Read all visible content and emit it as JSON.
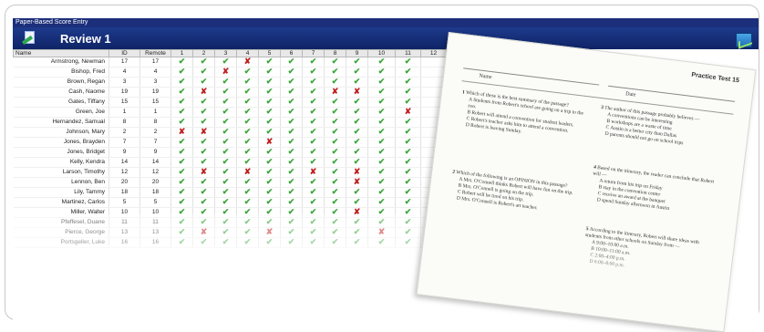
{
  "window_title": "Paper-Based Score Entry",
  "header_title": "Review 1",
  "columns": [
    "Name",
    "ID",
    "Remote",
    "1",
    "2",
    "3",
    "4",
    "5",
    "6",
    "7",
    "8",
    "9",
    "10",
    "11",
    "12"
  ],
  "rows": [
    {
      "name": "Armstrong, Newman",
      "id": "17",
      "remote": "17",
      "marks": [
        "c",
        "c",
        "c",
        "x",
        "c",
        "c",
        "c",
        "c",
        "c",
        "c",
        "c"
      ]
    },
    {
      "name": "Bishop, Fred",
      "id": "4",
      "remote": "4",
      "marks": [
        "c",
        "c",
        "x",
        "c",
        "c",
        "c",
        "c",
        "c",
        "c",
        "c",
        "c"
      ]
    },
    {
      "name": "Brown, Regan",
      "id": "3",
      "remote": "3",
      "marks": [
        "c",
        "c",
        "c",
        "c",
        "c",
        "c",
        "c",
        "c",
        "c",
        "c",
        "c"
      ]
    },
    {
      "name": "Cash, Naome",
      "id": "19",
      "remote": "19",
      "marks": [
        "c",
        "x",
        "c",
        "c",
        "c",
        "c",
        "c",
        "x",
        "x",
        "c",
        "c"
      ]
    },
    {
      "name": "Gates, Tiffany",
      "id": "15",
      "remote": "15",
      "marks": [
        "c",
        "c",
        "c",
        "c",
        "c",
        "c",
        "c",
        "c",
        "c",
        "c",
        "c"
      ]
    },
    {
      "name": "Green, Joe",
      "id": "1",
      "remote": "1",
      "marks": [
        "c",
        "c",
        "c",
        "c",
        "c",
        "c",
        "c",
        "c",
        "c",
        "c",
        "x"
      ]
    },
    {
      "name": "Hernandez, Samual",
      "id": "8",
      "remote": "8",
      "marks": [
        "c",
        "c",
        "c",
        "c",
        "c",
        "c",
        "c",
        "c",
        "c",
        "c",
        "c"
      ]
    },
    {
      "name": "Johnson, Mary",
      "id": "2",
      "remote": "2",
      "marks": [
        "x",
        "x",
        "c",
        "c",
        "c",
        "c",
        "c",
        "c",
        "c",
        "c",
        "c"
      ]
    },
    {
      "name": "Jones, Brayden",
      "id": "7",
      "remote": "7",
      "marks": [
        "c",
        "c",
        "c",
        "c",
        "x",
        "c",
        "c",
        "c",
        "c",
        "c",
        "c"
      ]
    },
    {
      "name": "Jones, Bridget",
      "id": "9",
      "remote": "9",
      "marks": [
        "c",
        "c",
        "c",
        "c",
        "c",
        "c",
        "c",
        "c",
        "c",
        "c",
        "c"
      ]
    },
    {
      "name": "Kelly, Kendra",
      "id": "14",
      "remote": "14",
      "marks": [
        "c",
        "c",
        "c",
        "c",
        "c",
        "c",
        "c",
        "c",
        "c",
        "c",
        "c"
      ]
    },
    {
      "name": "Larson, Timothy",
      "id": "12",
      "remote": "12",
      "marks": [
        "c",
        "x",
        "c",
        "x",
        "c",
        "c",
        "x",
        "c",
        "x",
        "c",
        "c"
      ]
    },
    {
      "name": "Lennon, Ben",
      "id": "20",
      "remote": "20",
      "marks": [
        "c",
        "c",
        "c",
        "c",
        "c",
        "c",
        "c",
        "c",
        "x",
        "c",
        "c"
      ]
    },
    {
      "name": "Lily, Tammy",
      "id": "18",
      "remote": "18",
      "marks": [
        "c",
        "c",
        "c",
        "c",
        "c",
        "c",
        "c",
        "c",
        "c",
        "c",
        "c"
      ]
    },
    {
      "name": "Martinez, Carlos",
      "id": "5",
      "remote": "5",
      "marks": [
        "c",
        "c",
        "c",
        "c",
        "c",
        "c",
        "c",
        "c",
        "c",
        "c",
        "c"
      ]
    },
    {
      "name": "Miller, Walter",
      "id": "10",
      "remote": "10",
      "marks": [
        "c",
        "c",
        "c",
        "c",
        "c",
        "c",
        "c",
        "c",
        "x",
        "c",
        "c"
      ]
    },
    {
      "name": "Pfeffesel, Duane",
      "id": "11",
      "remote": "11",
      "marks": [
        "c",
        "c",
        "c",
        "c",
        "c",
        "c",
        "c",
        "c",
        "c",
        "c",
        "c"
      ]
    },
    {
      "name": "Pierce, George",
      "id": "13",
      "remote": "13",
      "marks": [
        "c",
        "x",
        "c",
        "c",
        "x",
        "c",
        "c",
        "c",
        "c",
        "x",
        "c"
      ]
    },
    {
      "name": "Portsgeller, Luke",
      "id": "16",
      "remote": "16",
      "marks": [
        "c",
        "c",
        "c",
        "c",
        "c",
        "c",
        "c",
        "c",
        "c",
        "c",
        "c"
      ]
    }
  ],
  "paper": {
    "test_title": "Practice Test 15",
    "name_label": "Name",
    "date_label": "Date",
    "q1": "Which of these is the best summary of the passage?",
    "q1_opts": [
      "Students from Robert's school are going on a trip to the zoo.",
      "Robert will attend a convention for student leaders.",
      "Robert's teacher asks him to attend a convention.",
      "Robert is leaving Sunday."
    ],
    "q2": "Which of the following is an OPINION in this passage?",
    "q2_opts": [
      "Mrs. O'Connell thinks Robert will have fun on the trip.",
      "Mrs. O'Connell is going on the trip.",
      "Robert will be tired on his trip.",
      "Mrs. O'Connell is Robert's art teacher."
    ],
    "q3": "The author of this passage probably believes —",
    "q3_opts": [
      "conventions can be interesting",
      "workshops are a waste of time",
      "Austin is a better city than Dallas",
      "parents should not go on school trips"
    ],
    "q4": "Based on the itinerary, the reader can conclude that Robert will —",
    "q4_opts": [
      "return from his trip on Friday",
      "stay in the convention center",
      "receive an award at the banquet",
      "spend Sunday afternoon in Austin"
    ],
    "q5": "According to the itinerary, Robert will share ideas with students from other schools on Sunday from —",
    "q5_opts": [
      "9:00–10:00 a.m.",
      "10:00–11:00 a.m.",
      "2:00–4:00 p.m.",
      "6:00–8:00 p.m."
    ]
  }
}
